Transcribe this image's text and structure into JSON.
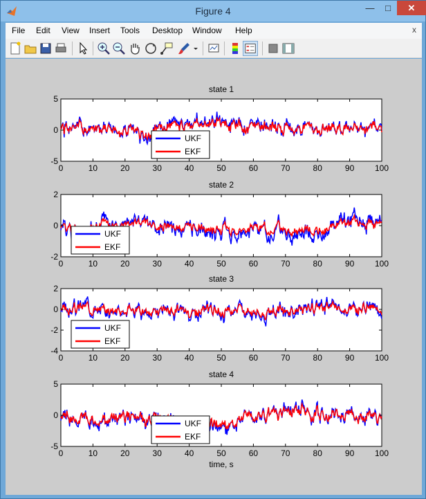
{
  "window": {
    "title": "Figure 4",
    "minimize_glyph": "—",
    "maximize_glyph": "□",
    "close_glyph": "✕"
  },
  "menubar": {
    "items": [
      {
        "label": "File"
      },
      {
        "label": "Edit"
      },
      {
        "label": "View"
      },
      {
        "label": "Insert"
      },
      {
        "label": "Tools"
      },
      {
        "label": "Desktop"
      },
      {
        "label": "Window"
      },
      {
        "label": "Help"
      }
    ],
    "close_glyph": "x"
  },
  "toolbar": {
    "buttons": [
      "new-figure-icon",
      "open-file-icon",
      "save-icon",
      "print-icon",
      "edit-plot-arrow-icon",
      "zoom-in-icon",
      "zoom-out-icon",
      "pan-hand-icon",
      "rotate-3d-icon",
      "data-cursor-icon",
      "brush-icon",
      "link-plot-icon",
      "colorbar-icon",
      "legend-icon",
      "hide-plot-tools-icon",
      "show-plot-tools-icon"
    ],
    "active": [
      "legend-icon"
    ]
  },
  "colors": {
    "ukf": "#0000ff",
    "ekf": "#ff0000",
    "figure_bg": "#cccccc",
    "axes_bg": "#ffffff"
  },
  "chart_data": [
    {
      "type": "line",
      "title": "state 1",
      "xlabel": "",
      "ylabel": "",
      "xlim": [
        0,
        100
      ],
      "ylim": [
        -5,
        5
      ],
      "xticks": [
        "0",
        "10",
        "20",
        "30",
        "40",
        "50",
        "60",
        "70",
        "80",
        "90",
        "100"
      ],
      "yticks": [
        "-5",
        "0",
        "5"
      ],
      "legend": {
        "entries": [
          "UKF",
          "EKF"
        ],
        "placement": "lower-center"
      },
      "series": [
        {
          "name": "UKF",
          "color": "#0000ff",
          "amp": 1.3,
          "seed": 1
        },
        {
          "name": "EKF",
          "color": "#ff0000",
          "amp": 1.1,
          "seed": 1
        }
      ]
    },
    {
      "type": "line",
      "title": "state 2",
      "xlabel": "",
      "ylabel": "",
      "xlim": [
        0,
        100
      ],
      "ylim": [
        -2,
        2
      ],
      "xticks": [
        "0",
        "10",
        "20",
        "30",
        "40",
        "50",
        "60",
        "70",
        "80",
        "90",
        "100"
      ],
      "yticks": [
        "-2",
        "0",
        "2"
      ],
      "legend": {
        "entries": [
          "UKF",
          "EKF"
        ],
        "placement": "lower-left"
      },
      "series": [
        {
          "name": "UKF",
          "color": "#0000ff",
          "amp": 0.55,
          "seed": 2
        },
        {
          "name": "EKF",
          "color": "#ff0000",
          "amp": 0.35,
          "seed": 2
        }
      ]
    },
    {
      "type": "line",
      "title": "state 3",
      "xlabel": "",
      "ylabel": "",
      "xlim": [
        0,
        100
      ],
      "ylim": [
        -4,
        2
      ],
      "xticks": [
        "0",
        "10",
        "20",
        "30",
        "40",
        "50",
        "60",
        "70",
        "80",
        "90",
        "100"
      ],
      "yticks": [
        "-4",
        "-2",
        "0",
        "2"
      ],
      "legend": {
        "entries": [
          "UKF",
          "EKF"
        ],
        "placement": "lower-left"
      },
      "series": [
        {
          "name": "UKF",
          "color": "#0000ff",
          "amp": 0.75,
          "seed": 3
        },
        {
          "name": "EKF",
          "color": "#ff0000",
          "amp": 0.55,
          "seed": 3
        }
      ]
    },
    {
      "type": "line",
      "title": "state 4",
      "xlabel": "time, s",
      "ylabel": "",
      "xlim": [
        0,
        100
      ],
      "ylim": [
        -5,
        5
      ],
      "xticks": [
        "0",
        "10",
        "20",
        "30",
        "40",
        "50",
        "60",
        "70",
        "80",
        "90",
        "100"
      ],
      "yticks": [
        "-5",
        "0",
        "5"
      ],
      "legend": {
        "entries": [
          "UKF",
          "EKF"
        ],
        "placement": "lower-center"
      },
      "series": [
        {
          "name": "UKF",
          "color": "#0000ff",
          "amp": 1.3,
          "seed": 4
        },
        {
          "name": "EKF",
          "color": "#ff0000",
          "amp": 1.15,
          "seed": 4
        }
      ]
    }
  ]
}
